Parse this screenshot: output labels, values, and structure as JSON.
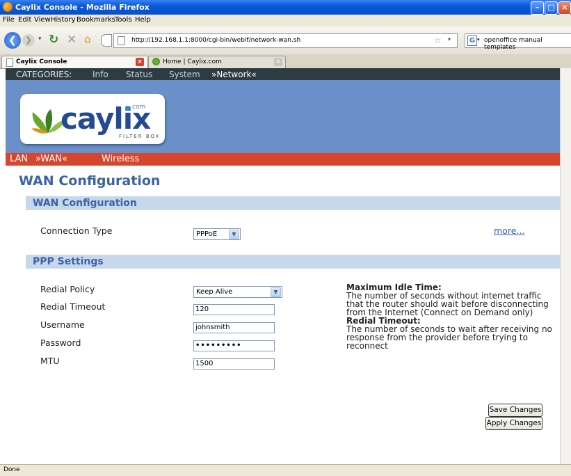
{
  "window": {
    "title": "Caylix Console - Mozilla Firefox"
  },
  "menu": [
    "File",
    "Edit",
    "View",
    "History",
    "Bookmarks",
    "Tools",
    "Help"
  ],
  "toolbar": {
    "url": "http://192.168.1.1:8000/cgi-bin/webif/network-wan.sh",
    "search_text": "openoffice manual templates"
  },
  "tabs": [
    {
      "label": "Caylix Console"
    },
    {
      "label": "Home | Caylix.com"
    }
  ],
  "categories": {
    "label": "CATEGORIES:",
    "items": [
      "Info",
      "Status",
      "System",
      "»Network«"
    ]
  },
  "logo": {
    "brand": "caylix",
    "dot": "com",
    "sub": "FILTER BOX"
  },
  "subnav": [
    "LAN",
    "»WAN«",
    "Wireless"
  ],
  "page_title": "WAN Configuration",
  "wan_section": {
    "title": "WAN Configuration",
    "connection_type_label": "Connection Type",
    "connection_type_value": "PPPoE",
    "more_link": "more..."
  },
  "ppp_section": {
    "title": "PPP Settings",
    "fields": {
      "redial_policy": {
        "label": "Redial Policy",
        "value": "Keep Alive"
      },
      "redial_timeout": {
        "label": "Redial Timeout",
        "value": "120"
      },
      "username": {
        "label": "Username",
        "value": "johnsmith"
      },
      "password": {
        "label": "Password",
        "value": "•••••••••"
      },
      "mtu": {
        "label": "MTU",
        "value": "1500"
      }
    },
    "help": {
      "idle_title": "Maximum Idle Time:",
      "idle_text": "The number of seconds without internet traffic that the router should wait before disconnecting from the Internet (Connect on Demand only)",
      "redial_title": "Redial Timeout:",
      "redial_text": "The number of seconds to wait after receiving no response from the provider before trying to reconnect"
    }
  },
  "buttons": {
    "save": "Save Changes",
    "apply": "Apply Changes"
  },
  "status": {
    "text": "Done"
  },
  "colors": {
    "header_blue": "#6a8fc9",
    "subnav_red": "#d7462c",
    "heading_blue": "#3b63a6",
    "section_bg": "#c7d8ea"
  }
}
